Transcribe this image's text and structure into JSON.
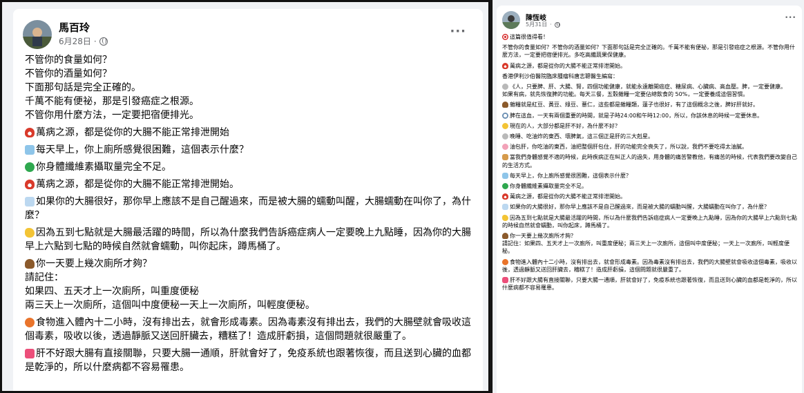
{
  "left_post": {
    "author": "馬百玲",
    "date": "6月28日",
    "more": "···",
    "paragraphs": [
      "不管你的食量如何？\n不管你的酒量如何？\n下面那句話是完全正確的。\n千萬不能有便祕，那是引發癌症之根源。\n不管你用什麼方法，一定要把宿便排光。",
      "萬病之源，都是從你的大腸不能正常排泄開始",
      "每天早上，你上廁所感覺很困難，這個表示什麼？",
      "你身體纖維素攝取量完全不足。",
      "萬病之源，都是從你的大腸不能正常排泄開始。",
      "如果你的大腸很好，那你早上應該不是自己醒過來，而是被大腸的蠕動叫醒，大腸蠕動在叫你了，為什麼？",
      "因為五到七點就是大腸最活躍的時間，所以為什麼我們告訴癌症病人一定要晚上九點睡，因為你的大腸早上六點到七點的時候自然就會蠕動，叫你起床，蹲馬桶了。",
      "你一天要上幾次廁所才夠？\n請記住：\n如果四、五天才上一次廁所，叫重度便秘\n兩三天上一次廁所，這個叫中度便秘一天上一次廁所，叫輕度便秘。",
      "食物進入體內十二小時，沒有排出去，就會形成毒素。因為毒素沒有排出去，我們的大腸壁就會吸收這個毒素，吸收以後，透過靜脈又送回肝臟去，糟糕了！造成肝虧損，這個問題就很嚴重了。",
      "肝不好跟大腸有直接關聯，只要大腸一通順，肝就會好了，免疫系統也跟著恢復，而且送到心臟的血都是乾淨的，所以什麼病都不容易罹患。"
    ]
  },
  "right_post": {
    "author": "陳恆岐",
    "date": "5月31日",
    "more": "···",
    "paragraphs": [
      "這篇很值得看！",
      "不管你的食量如何？不管你的酒量如何？下面那句話是完全正確的。千萬不能有便祕，那是引發癌症之根源。不管你用什麼方法，一定要把宿便排光。多吃高纖蔬果保健康。",
      "萬病之源，都是從你的大腸不能正常排泄開始。",
      "香港伊利沙伯醫院臨床腫瘤科唐志聰醫生編寫：",
      "《人，只要脾、肝、大腸、腎，四個功能健康，就能永遠離開癌症、糖尿病、心臟病、高血壓。脾，一定要健康。\n如果有病，就先恢復脾的功能。每天三餐，五穀雜糧一定要佔總飲食的 50%，一定要養成這個習慣。",
      "雜糧就是紅豆、黃豆、綠豆、薏仁，這些都是雜糧類，蓮子也很好，有了這個概念之後，脾好肝就好。",
      "脾在這血，一天有兩個重要的時間，就是子時24:00和午時12:00，所以，你該休息的時候一定要休息。",
      "現在的人，大部分都是肝不好，為什麼不好？",
      "晚睡、吃油炸的東西、壞脾氣，這三個正是肝的三大剋星。",
      "油包肝，你吃油的東西，油把整個肝包住，肝的功能完全喪失了，所以說，我們不要吃得太油膩。",
      "當我們身體感覺不適的時候，此時疾病正在糾正人的過失，用身體的痛苦警教他，有痛苦的時候，代表我們要改變自己的生活方式。",
      "每天早上，你上廁所感覺很困難，這個表示什麼？",
      "你身體纖維素攝取量完全不足。",
      "萬病之源，都是從你的大腸不能正常排泄開始。",
      "如果你的大腸很好，那你早上應該不是自己醒過來，而是被大腸的蠕動叫醒，大腸蠕動在叫你了，為什麼？",
      "因為五到七點就是大腸最活躍的時間，所以為什麼我們告訴癌症病人一定要晚上九點睡，因為你的大腸早上六點到七點的時候自然就會蠕動，叫你起床，蹲馬桶了。",
      "你一天要上幾次廁所才夠？\n請記住：如果四、五天才上一次廁所，叫重度便秘；兩三天上一次廁所，這個叫中度便秘；一天上一次廁所，叫輕度便秘。",
      "食物進入體內十二小時，沒有排出去，就會形成毒素。因為毒素沒有排出去，我們的大腸壁就會吸收這個毒素，吸收以後，透過靜脈又送回肝臟去，糟糕了！造成肝虧損，這個問題就很嚴重了。",
      "肝不好跟大腸有直接關聯，只要大腸一通順，肝就會好了，免疫系統也跟著恢復，而且送到心臟的血都是乾淨的，所以什麼病都不容易罹患。"
    ]
  },
  "icons": {
    "left": [
      "",
      "mushroom-icon",
      "toilet-icon",
      "recycle-icon",
      "mushroom-icon",
      "baby-bottle-icon",
      "banana-icon",
      "poop-icon",
      "cyclist-icon",
      "heart-icon"
    ],
    "right": [
      "target-icon",
      "",
      "lips-icon",
      "",
      "person-icon",
      "bowl-icon",
      "clock-icon",
      "sunglasses-face-icon",
      "hand-icon",
      "pig-icon",
      "kneeling-person-icon",
      "toilet-icon",
      "recycle-icon",
      "lips-icon",
      "baby-bottle-icon",
      "banana-icon",
      "poop-icon",
      "cyclist-icon",
      "heart-icon"
    ]
  }
}
